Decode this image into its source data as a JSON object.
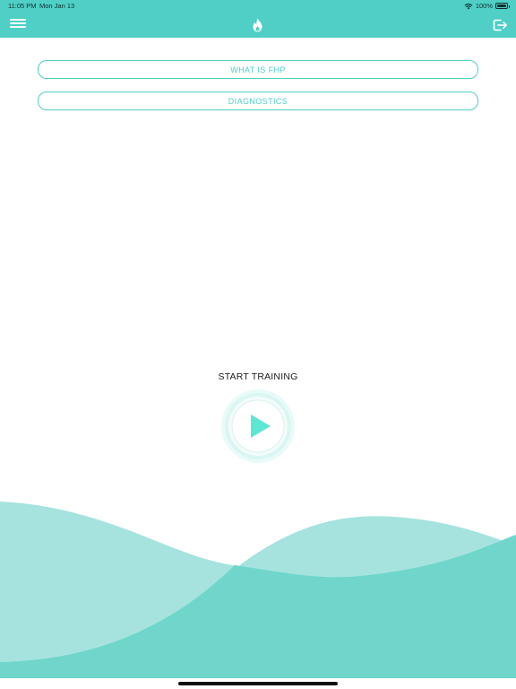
{
  "status_bar": {
    "time": "11:05 PM",
    "date": "Mon Jan 13",
    "battery": "100%"
  },
  "header": {
    "menu_icon": "hamburger-menu-icon",
    "logo_icon": "flame-icon",
    "logout_icon": "logout-icon"
  },
  "buttons": {
    "what_is_fhp": "WHAT IS FHP",
    "diagnostics": "DIAGNOSTICS"
  },
  "training": {
    "label": "START TRAINING",
    "play_icon": "play-icon"
  },
  "colors": {
    "accent": "#4fcfc6",
    "wave_light": "#a6e3df",
    "wave_dark": "#6fd8cc",
    "play": "#5ee6d4"
  }
}
